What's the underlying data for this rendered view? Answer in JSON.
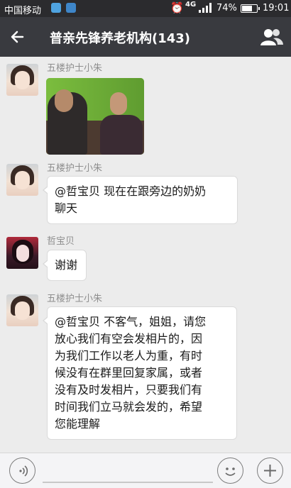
{
  "status_bar": {
    "carrier": "中国移动",
    "network_1": "4G",
    "battery_percent": "74%",
    "battery_level": 0.74,
    "time": "19:01"
  },
  "header": {
    "title": "普亲先锋养老机构(143)",
    "back_icon": "back-arrow-icon",
    "members_icon": "group-members-icon"
  },
  "messages": [
    {
      "sender": "五楼护士小朱",
      "type": "image"
    },
    {
      "sender": "五楼护士小朱",
      "type": "text",
      "lines": [
        "@哲宝贝 现在在跟旁边的奶奶",
        "聊天"
      ]
    },
    {
      "sender": "哲宝贝",
      "type": "text",
      "lines": [
        "谢谢"
      ]
    },
    {
      "sender": "五楼护士小朱",
      "type": "text",
      "lines": [
        "@哲宝贝 不客气，姐姐，请您",
        "放心我们有空会发相片的，因",
        "为我们工作以老人为重，有时",
        "候没有在群里回复家属，或者",
        "没有及时发相片，只要我们有",
        "时间我们立马就会发的，希望",
        "您能理解"
      ]
    }
  ],
  "input_bar": {
    "voice_icon": "voice-icon",
    "emoji_icon": "emoji-icon",
    "plus_icon": "plus-icon",
    "text_value": ""
  }
}
